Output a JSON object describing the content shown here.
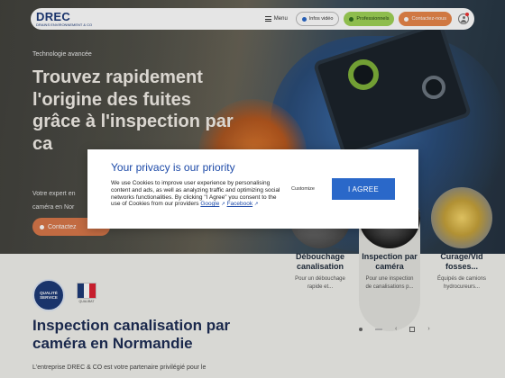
{
  "header": {
    "logo": "DREC",
    "logo_sub": "DRAINS ENVIRONNEMENT & CO",
    "menu_label": "Menu",
    "video_label": "Infos vidéo",
    "pro_label": "Professionnels",
    "contact_label": "Contactez-nous"
  },
  "hero": {
    "kicker": "Technologie avancée",
    "headline": "Trouvez rapidement l'origine des fuites grâce à l'inspection par ca",
    "lead_line1": "Votre expert en",
    "lead_line2": "caméra en Nor",
    "cta": "Contactez"
  },
  "cards": [
    {
      "title": "Débouchage canalisation",
      "desc": "Pour un débouchage rapide et..."
    },
    {
      "title": "Inspection par caméra",
      "desc": "Pour une inspection de canalisations p..."
    },
    {
      "title": "Curage/Vid fosses...",
      "desc": "Équipés de camions hydrocureurs..."
    }
  ],
  "badges": {
    "badge1": "QUALITÉ SERVICE",
    "badge2": "QUALIBAT"
  },
  "section": {
    "title": "Inspection canalisation par caméra en Normandie",
    "text": "L'entreprise DREC & CO est votre partenaire privilégié pour le"
  },
  "cookie": {
    "title": "Your privacy is our priority",
    "text": "We use Cookies to improve user experience by personalising content and ads, as well as analyzing traffic and optimizing social networks functionalities. By clicking \"I Agree\" you consent to the use of Cookies from our providers",
    "link_google": "Google",
    "link_facebook": "Facebook",
    "customize": "Customize",
    "agree": "I AGREE"
  },
  "colors": {
    "brand_blue": "#1d3a78",
    "accent_orange": "#e8864a",
    "accent_green": "#9fd356",
    "button_blue": "#2a68c9"
  }
}
